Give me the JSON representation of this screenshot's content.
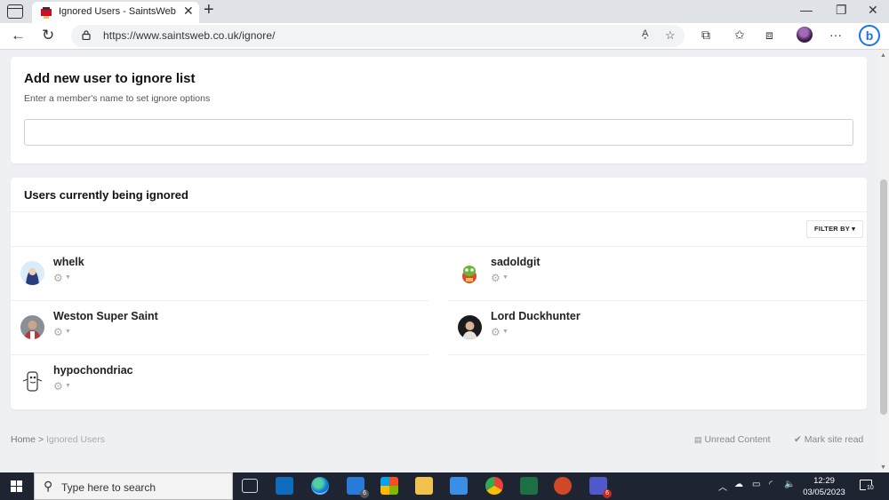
{
  "browser": {
    "tab_title": "Ignored Users - SaintsWeb",
    "url": "https://www.saintsweb.co.uk/ignore/",
    "read_aloud_label": "A͓"
  },
  "page": {
    "add_card": {
      "title": "Add new user to ignore list",
      "subtitle": "Enter a member's name to set ignore options",
      "input_value": "",
      "input_placeholder": ""
    },
    "ignored_card": {
      "title": "Users currently being ignored",
      "filter_label": "FILTER BY ▾",
      "users": [
        {
          "name": "whelk"
        },
        {
          "name": "sadoldgit"
        },
        {
          "name": "Weston Super Saint"
        },
        {
          "name": "Lord Duckhunter"
        },
        {
          "name": "hypochondriac"
        }
      ]
    },
    "footer": {
      "breadcrumb_home": "Home",
      "breadcrumb_sep": ">",
      "breadcrumb_current": "Ignored Users",
      "unread_content": "Unread Content",
      "mark_site_read": "Mark site read"
    }
  },
  "taskbar": {
    "search_text": "Type here to search",
    "time": "12:29",
    "date": "03/05/2023",
    "outlook_badge": "6",
    "teams_badge": "6",
    "notification_count": "10"
  },
  "colors": {
    "page_bg": "#eef0f3",
    "card_bg": "#ffffff",
    "taskbar_bg": "#1f2433",
    "accent_blue": "#1a73e8"
  }
}
